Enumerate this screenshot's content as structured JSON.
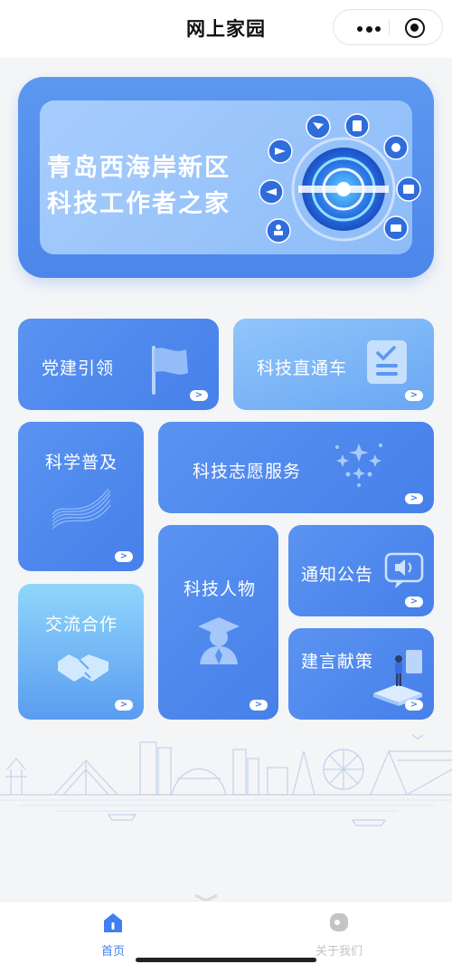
{
  "topbar": {
    "title": "网上家园"
  },
  "banner": {
    "line1": "青岛西海岸新区",
    "line2": "科技工作者之家"
  },
  "cards": {
    "party": {
      "label": "党建引领"
    },
    "express": {
      "label": "科技直通车"
    },
    "popular": {
      "label": "科学普及"
    },
    "volunteer": {
      "label": "科技志愿服务"
    },
    "people": {
      "label": "科技人物"
    },
    "notice": {
      "label": "通知公告"
    },
    "exchange": {
      "label": "交流合作"
    },
    "suggest": {
      "label": "建言献策"
    },
    "arrow_glyph": ">"
  },
  "bottom_nav": {
    "home": {
      "label": "首页",
      "color": "#3f7ff0"
    },
    "about": {
      "label": "关于我们",
      "color": "#c4c4c4"
    }
  },
  "colors": {
    "accent": "#4a86ea",
    "card_light": "#8fc3fa"
  }
}
